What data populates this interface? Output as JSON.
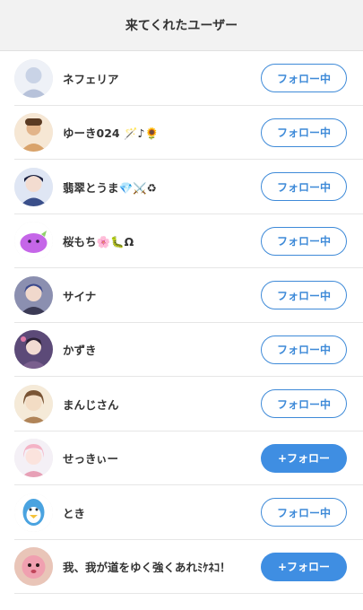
{
  "header": {
    "title": "来てくれたユーザー"
  },
  "users": [
    {
      "name": "ネフェリア",
      "button": "フォロー中",
      "state": "following",
      "avatar_color": "#c9d3e6",
      "avatar_icon": "avatar-icon"
    },
    {
      "name": "ゆーき024 🪄♪🌻",
      "button": "フォロー中",
      "state": "following",
      "avatar_color": "#d9a36b",
      "avatar_icon": "avatar-icon"
    },
    {
      "name": "翡翠とうま💎⚔️♻︎",
      "button": "フォロー中",
      "state": "following",
      "avatar_color": "#3a4f8a",
      "avatar_icon": "avatar-icon"
    },
    {
      "name": "桜もち🌸🐛Ω",
      "button": "フォロー中",
      "state": "following",
      "avatar_color": "#c566e8",
      "avatar_icon": "avatar-icon"
    },
    {
      "name": "サイナ",
      "button": "フォロー中",
      "state": "following",
      "avatar_color": "#3b3a55",
      "avatar_icon": "avatar-icon"
    },
    {
      "name": "かずき",
      "button": "フォロー中",
      "state": "following",
      "avatar_color": "#7a5f8e",
      "avatar_icon": "avatar-icon"
    },
    {
      "name": "まんじさん",
      "button": "フォロー中",
      "state": "following",
      "avatar_color": "#b08458",
      "avatar_icon": "avatar-icon"
    },
    {
      "name": "せっきぃー",
      "button": "+フォロー",
      "state": "follow",
      "avatar_color": "#f4b3c6",
      "avatar_icon": "avatar-icon"
    },
    {
      "name": "とき",
      "button": "フォロー中",
      "state": "following",
      "avatar_color": "#4aa3e0",
      "avatar_icon": "avatar-icon"
    },
    {
      "name": "我、我が道をゆく強くあれﾐｹﾈｺ！",
      "button": "+フォロー",
      "state": "follow",
      "avatar_color": "#c98a7a",
      "avatar_icon": "avatar-icon"
    }
  ],
  "colors": {
    "accent": "#3e8ad8",
    "follow_fill": "#3f8ee2",
    "header_bg": "#f2f2f2"
  }
}
